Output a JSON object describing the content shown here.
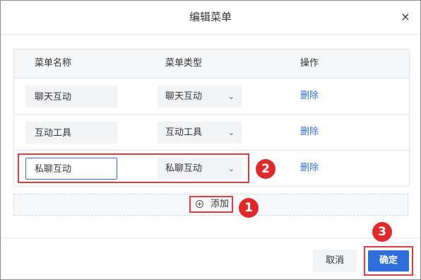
{
  "dialog": {
    "title": "编辑菜单",
    "close_icon": "close-icon",
    "close_glyph": "×"
  },
  "table": {
    "columns": [
      "菜单名称",
      "菜单类型",
      "操作"
    ],
    "rows": [
      {
        "name": "聊天互动",
        "type": "聊天互动",
        "action": "删除",
        "editing": false
      },
      {
        "name": "互动工具",
        "type": "互动工具",
        "action": "删除",
        "editing": false
      },
      {
        "name": "私聊互动",
        "type": "私聊互动",
        "action": "删除",
        "editing": true
      }
    ]
  },
  "add": {
    "label": "添加",
    "icon": "plus-circle-icon"
  },
  "footer": {
    "cancel_label": "取消",
    "ok_label": "确定"
  },
  "annotations": {
    "badges": [
      "1",
      "2",
      "3"
    ],
    "color": "#e02a2a"
  },
  "colors": {
    "accent": "#2f6fdc",
    "highlight": "#e23b3b"
  }
}
